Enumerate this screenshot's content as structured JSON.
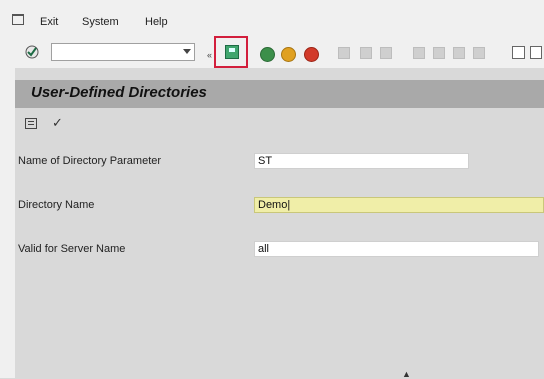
{
  "menu": {
    "items": [
      {
        "label": "Exit"
      },
      {
        "label": "System"
      },
      {
        "label": "Help"
      }
    ]
  },
  "toolbar": {
    "command_field": {
      "value": ""
    },
    "collapse_arrows": "«"
  },
  "screen": {
    "title": "User-Defined Directories"
  },
  "form": {
    "fields": [
      {
        "label": "Name of Directory Parameter",
        "value": "ST"
      },
      {
        "label": "Directory Name",
        "value": "Demo|"
      },
      {
        "label": "Valid for Server Name",
        "value": "all"
      }
    ]
  }
}
